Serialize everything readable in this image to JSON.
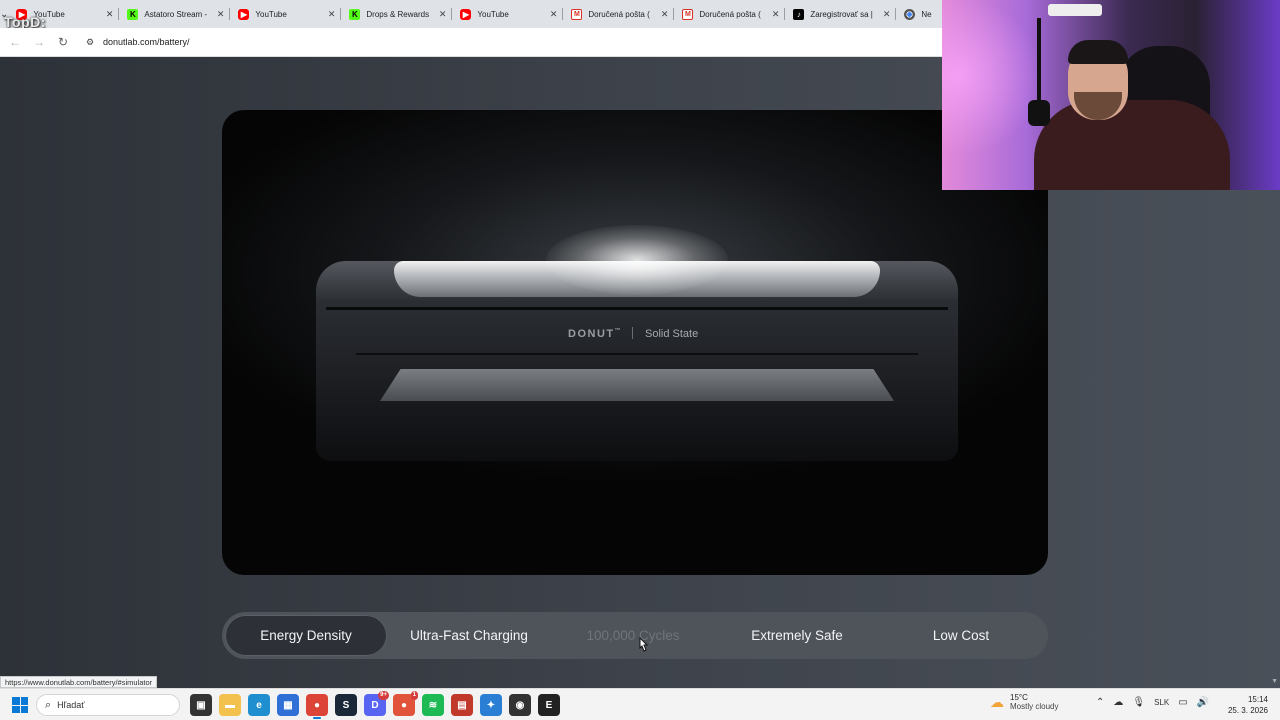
{
  "overlay_watermark": "TopD:",
  "browser": {
    "tab_search_icon": "chevron-down-icon",
    "tabs": [
      {
        "label": "YouTube",
        "favicon": "yt"
      },
      {
        "label": "Astatoro Stream -",
        "favicon": "kick"
      },
      {
        "label": "YouTube",
        "favicon": "yt"
      },
      {
        "label": "Drops & Rewards",
        "favicon": "kick"
      },
      {
        "label": "YouTube",
        "favicon": "yt"
      },
      {
        "label": "Doručená pošta (",
        "favicon": "gmail"
      },
      {
        "label": "Doručená pošta (",
        "favicon": "gmail"
      },
      {
        "label": "Zaregistrovať sa |",
        "favicon": "tiktok"
      },
      {
        "label": "Ne",
        "favicon": "chrome"
      }
    ],
    "url": "donutlab.com/battery/",
    "status_url": "https://www.donutlab.com/battery/#simulator"
  },
  "hero": {
    "brand": "DONUT",
    "trademark": "™",
    "model": "Solid State"
  },
  "feature_tabs": [
    {
      "label": "Energy Density",
      "state": "active"
    },
    {
      "label": "Ultra-Fast Charging",
      "state": "normal"
    },
    {
      "label": "100,000 Cycles",
      "state": "hover"
    },
    {
      "label": "Extremely Safe",
      "state": "normal"
    },
    {
      "label": "Low Cost",
      "state": "normal"
    }
  ],
  "taskbar": {
    "search_placeholder": "Hľadať",
    "weather_temp": "15°C",
    "weather_desc": "Mostly cloudy",
    "language": "SLK",
    "time": "15:14",
    "date": "25. 3. 2026",
    "apps": [
      {
        "name": "task-view-icon",
        "glyph": "▣",
        "color": "#333333"
      },
      {
        "name": "file-explorer-icon",
        "glyph": "▬",
        "color": "#f2c14e"
      },
      {
        "name": "edge-icon",
        "glyph": "e",
        "color": "#1f8fcf"
      },
      {
        "name": "store-icon",
        "glyph": "▦",
        "color": "#2f6fd6"
      },
      {
        "name": "chrome-icon",
        "glyph": "●",
        "color": "#db4437",
        "active": true
      },
      {
        "name": "steam-icon",
        "glyph": "S",
        "color": "#1b2838"
      },
      {
        "name": "discord-icon",
        "glyph": "D",
        "color": "#5865f2",
        "badge": "9+"
      },
      {
        "name": "app-badge-icon",
        "glyph": "●",
        "color": "#e2533b",
        "badge": "1"
      },
      {
        "name": "spotify-icon",
        "glyph": "≋",
        "color": "#1db954"
      },
      {
        "name": "media-app-icon",
        "glyph": "▤",
        "color": "#c0392b"
      },
      {
        "name": "photos-icon",
        "glyph": "✦",
        "color": "#2a7fd4"
      },
      {
        "name": "obs-icon",
        "glyph": "◉",
        "color": "#333333"
      },
      {
        "name": "epic-games-icon",
        "glyph": "E",
        "color": "#222222"
      }
    ]
  }
}
